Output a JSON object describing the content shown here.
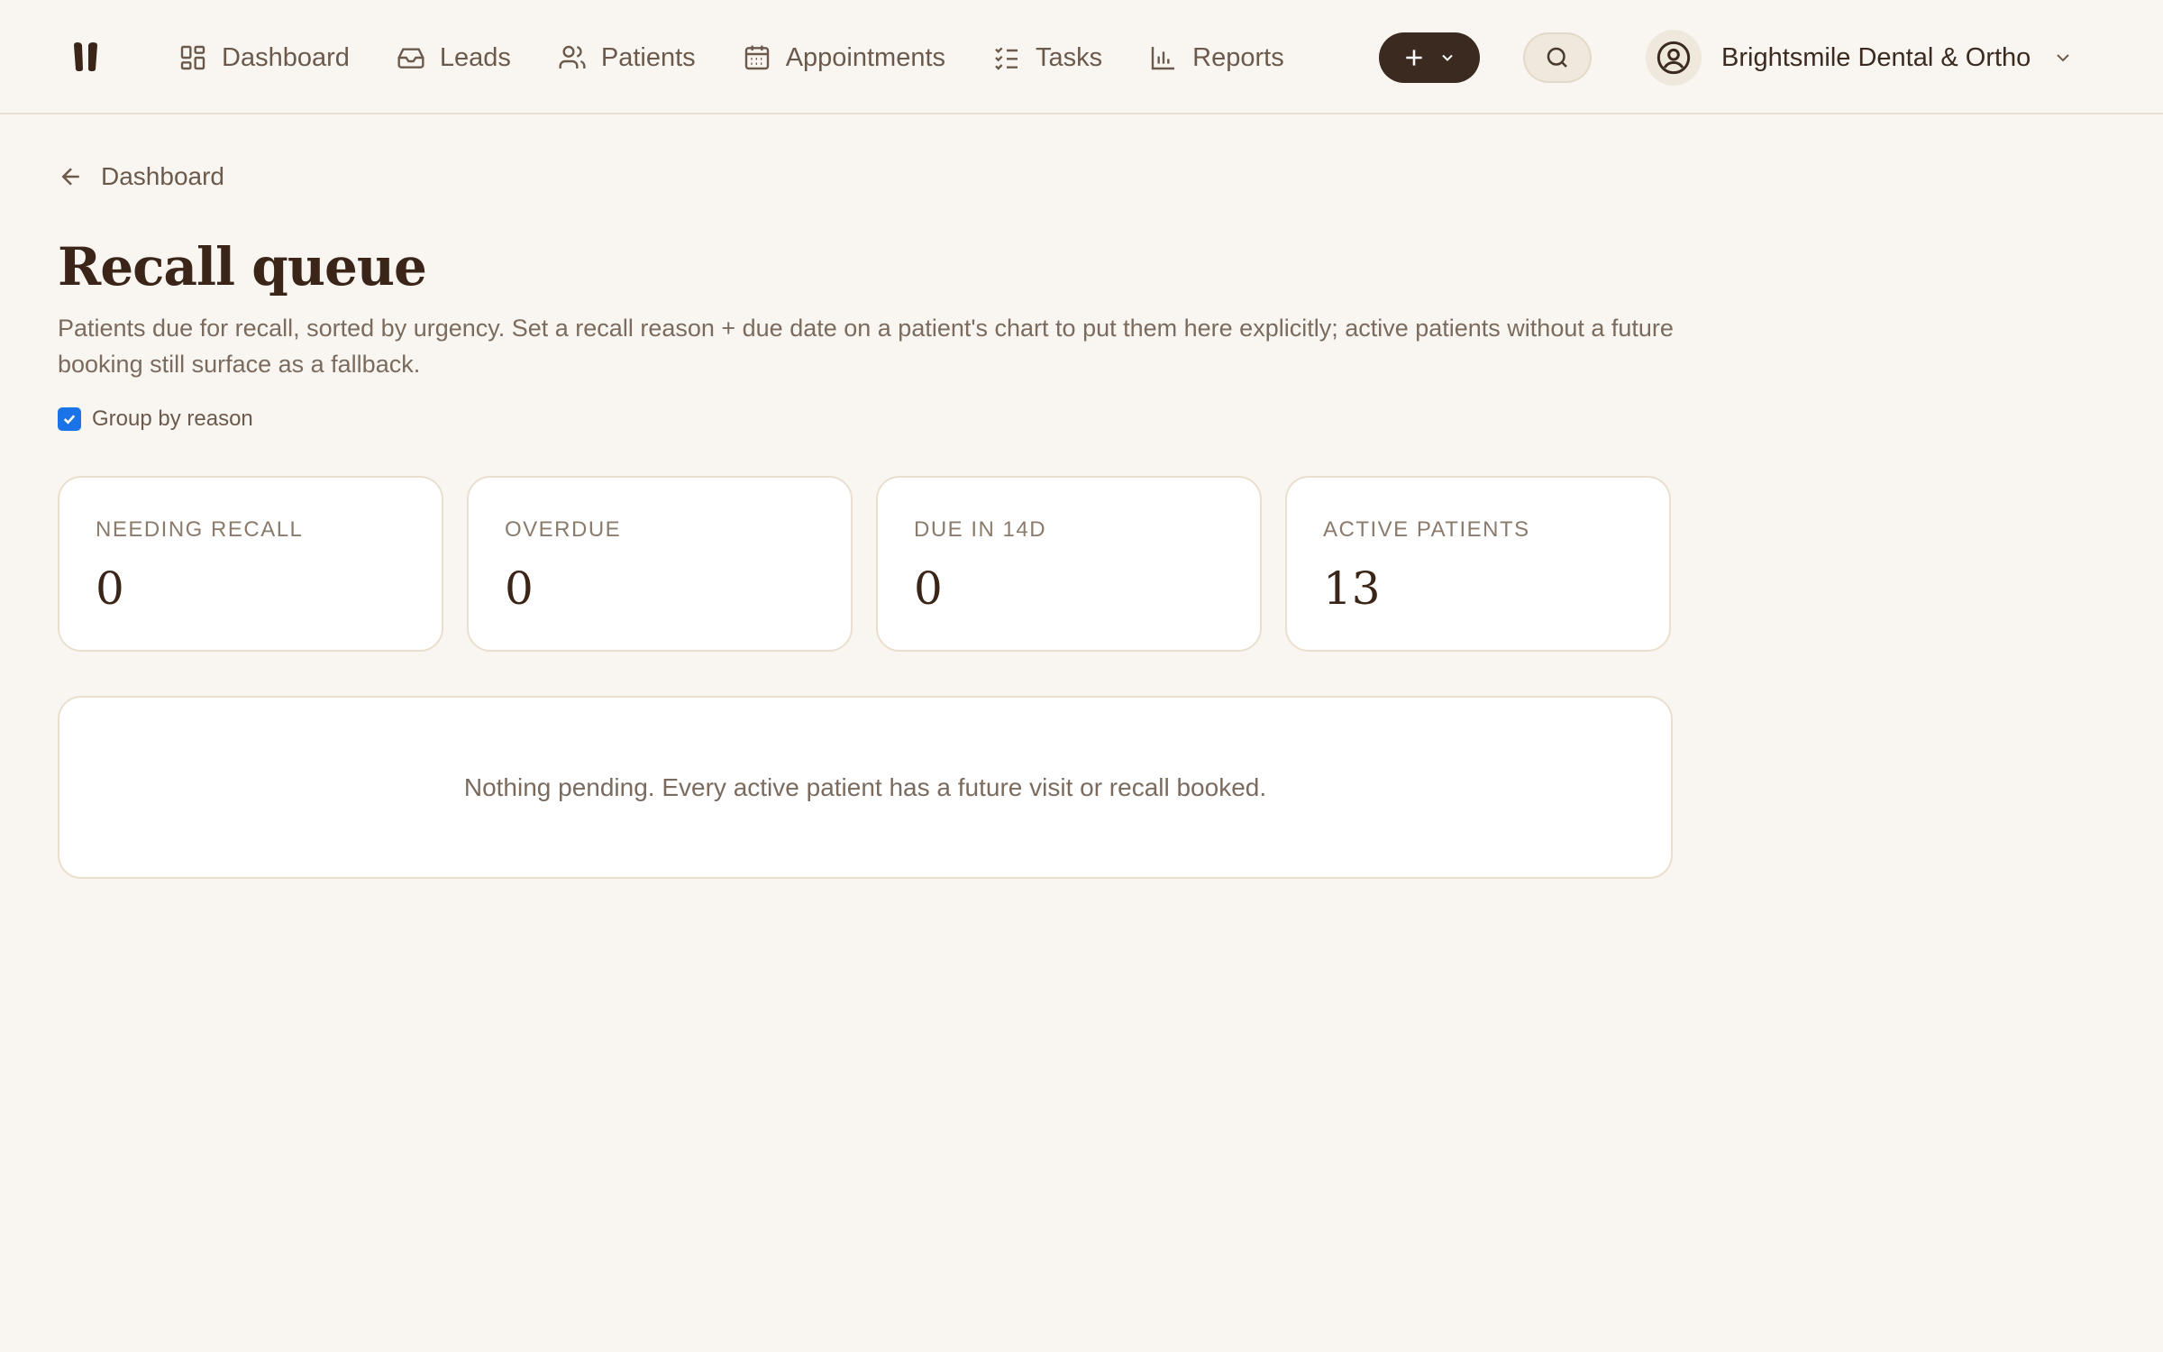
{
  "nav": {
    "items": [
      {
        "label": "Dashboard",
        "icon": "dashboard-grid-icon"
      },
      {
        "label": "Leads",
        "icon": "inbox-icon"
      },
      {
        "label": "Patients",
        "icon": "users-icon"
      },
      {
        "label": "Appointments",
        "icon": "calendar-icon"
      },
      {
        "label": "Tasks",
        "icon": "checklist-icon"
      },
      {
        "label": "Reports",
        "icon": "bar-chart-icon"
      }
    ],
    "new_icon": "plus-icon",
    "search_icon": "search-icon"
  },
  "account": {
    "name": "Brightsmile Dental & Ortho",
    "icon": "user-circle-icon"
  },
  "breadcrumb": {
    "back_label": "Dashboard"
  },
  "page": {
    "title": "Recall queue",
    "subtitle": "Patients due for recall, sorted by urgency. Set a recall reason + due date on a patient's chart to put them here explicitly; active patients without a future booking still surface as a fallback.",
    "group_by_label": "Group by reason",
    "group_by_checked": true
  },
  "stats": [
    {
      "label": "NEEDING RECALL",
      "value": "0"
    },
    {
      "label": "OVERDUE",
      "value": "0"
    },
    {
      "label": "DUE IN 14D",
      "value": "0"
    },
    {
      "label": "ACTIVE PATIENTS",
      "value": "13"
    }
  ],
  "empty_state": "Nothing pending. Every active patient has a future visit or recall booked.",
  "colors": {
    "accent_dark": "#3a2a1f",
    "background": "#f9f6f1",
    "checkbox": "#1a73e8"
  }
}
